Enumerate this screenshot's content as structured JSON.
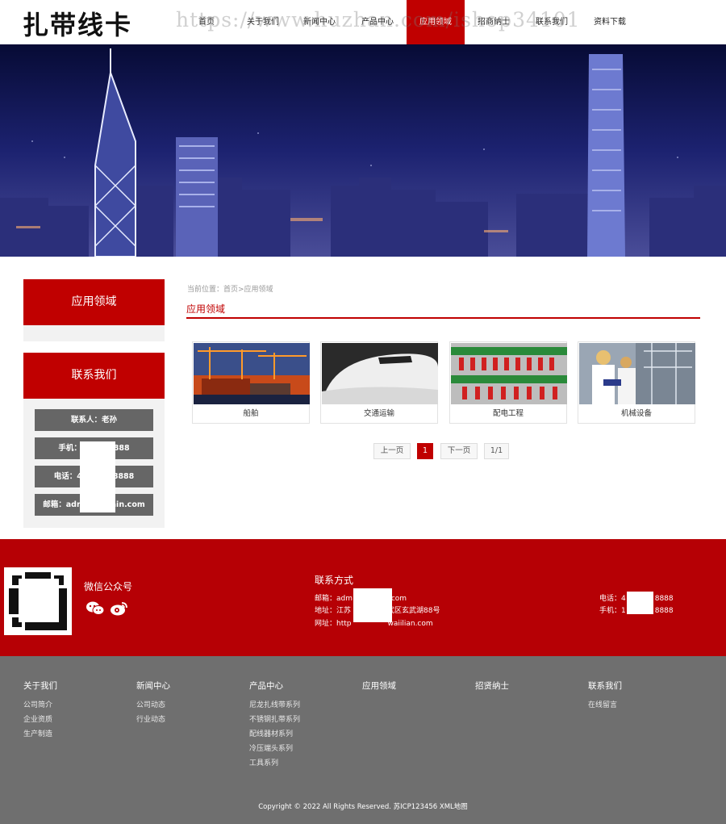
{
  "header": {
    "logo": "扎带线卡",
    "watermark": "https://www.huzhan.com/ishop34101",
    "nav": [
      {
        "label": "首页",
        "active": false
      },
      {
        "label": "关于我们",
        "active": false
      },
      {
        "label": "新闻中心",
        "active": false
      },
      {
        "label": "产品中心",
        "active": false
      },
      {
        "label": "应用领域",
        "active": true
      },
      {
        "label": "招商纳士",
        "active": false
      },
      {
        "label": "联系我们",
        "active": false
      },
      {
        "label": "资料下载",
        "active": false
      }
    ]
  },
  "sidebar": {
    "box1_title": "应用领域",
    "box2_title": "联系我们",
    "contact": {
      "person": "联系人：老孙",
      "mobile": "手机：　　　　8888",
      "phone": "电话：4　　　　8888",
      "email": "邮箱：adr　　　　ain.com"
    }
  },
  "main": {
    "breadcrumb": "当前位置：首页>应用领域",
    "title": "应用领域",
    "cards": [
      {
        "caption": "船舶"
      },
      {
        "caption": "交通运输"
      },
      {
        "caption": "配电工程"
      },
      {
        "caption": "机械设备"
      }
    ],
    "pager": {
      "prev": "上一页",
      "current": "1",
      "next": "下一页",
      "total": "1/1"
    }
  },
  "footer": {
    "wechat_title": "微信公众号",
    "contact_title": "联系方式",
    "email": "邮箱：adm　　　　　.com",
    "address": "地址：江苏　　　　　武区玄武湖88号",
    "website": "网址：http　　　　　waiilian.com",
    "phone": "电话：4　　　　8888",
    "mobile": "手机：1　　　　8888",
    "columns": [
      {
        "heading": "关于我们",
        "links": [
          "公司简介",
          "企业资质",
          "生产制造"
        ]
      },
      {
        "heading": "新闻中心",
        "links": [
          "公司动态",
          "行业动态"
        ]
      },
      {
        "heading": "产品中心",
        "links": [
          "尼龙扎线带系列",
          "不锈钢扎带系列",
          "配线器材系列",
          "冷压端头系列",
          "工具系列"
        ]
      },
      {
        "heading": "应用领域",
        "links": []
      },
      {
        "heading": "招贤纳士",
        "links": []
      },
      {
        "heading": "联系我们",
        "links": [
          "在线留言"
        ]
      }
    ],
    "copyright": "Copyright © 2022 All Rights Reserved. 苏ICP123456 XML地图"
  }
}
